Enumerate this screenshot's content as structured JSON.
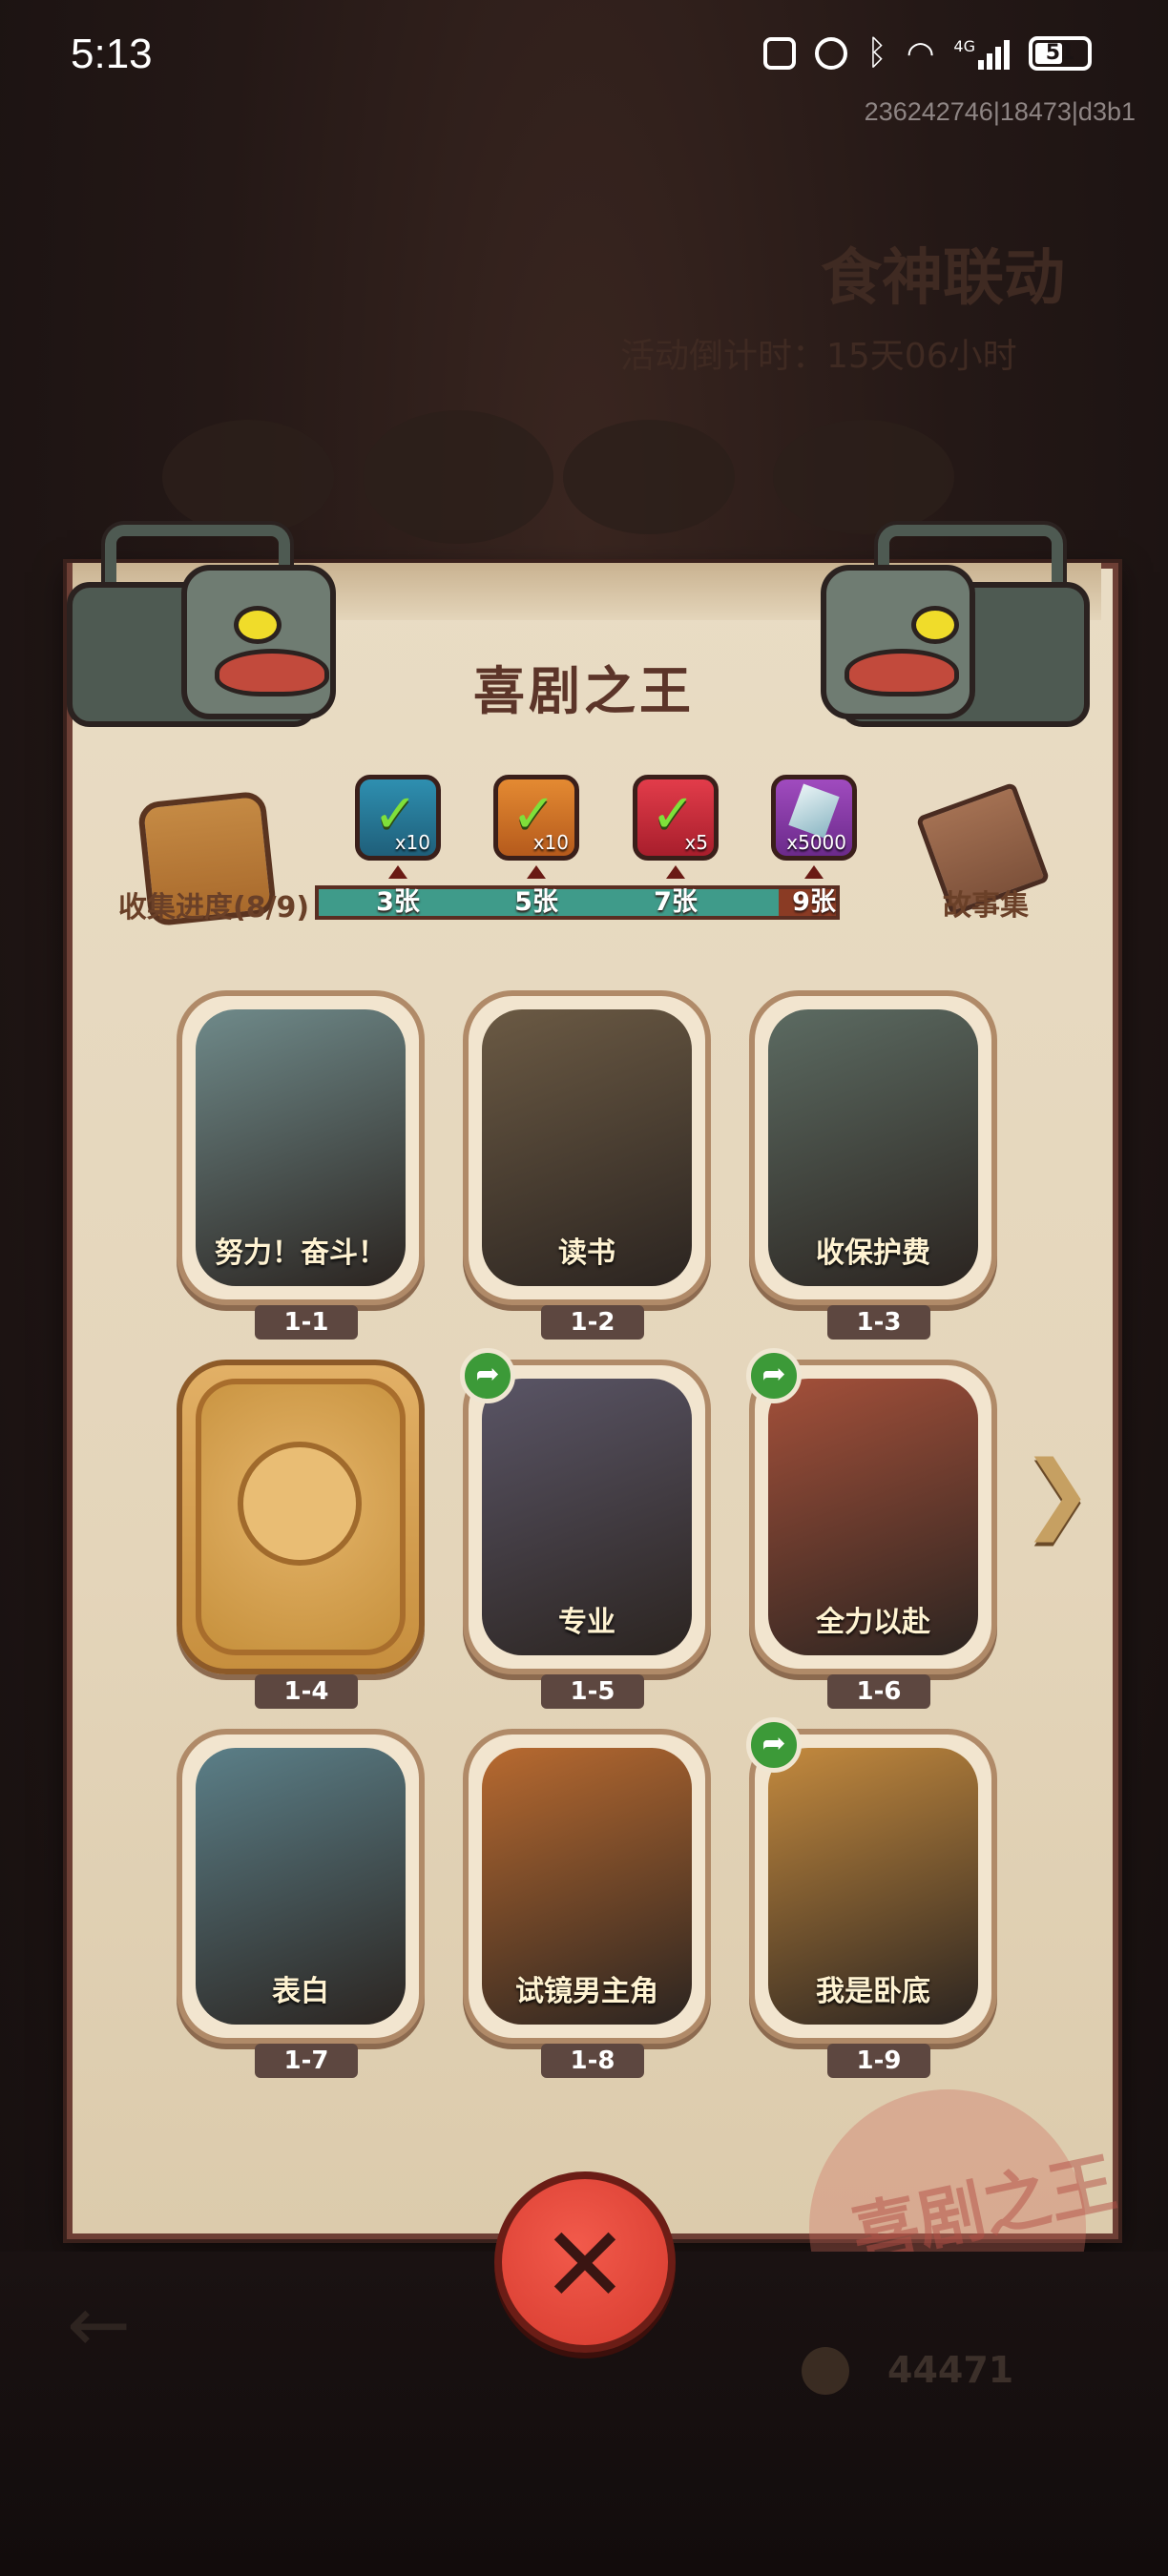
{
  "status_bar": {
    "time": "5:13",
    "battery": "51",
    "network": "4G",
    "session_id": "236242746|18473|d3b1"
  },
  "background": {
    "event_title": "食神联动",
    "countdown": "活动倒计时：15天06小时",
    "coins": "44471"
  },
  "panel": {
    "title": "喜剧之王",
    "collect_label": "收集进度(8/9)",
    "story_label": "故事集"
  },
  "progress": {
    "collected": 8,
    "total": 9,
    "milestones": [
      {
        "label": "3张",
        "reward_qty": "x10",
        "reward": "gift-box-icon",
        "claimed": true
      },
      {
        "label": "5张",
        "reward_qty": "x10",
        "reward": "gift-box-icon",
        "claimed": true
      },
      {
        "label": "7张",
        "reward_qty": "x5",
        "reward": "orb-icon",
        "claimed": true
      },
      {
        "label": "9张",
        "reward_qty": "x5000",
        "reward": "crystal-icon",
        "claimed": false
      }
    ]
  },
  "cards": [
    {
      "code": "1-1",
      "title": "努力！奋斗！",
      "locked": false,
      "shareable": false,
      "art": "#6f8a8a"
    },
    {
      "code": "1-2",
      "title": "读书",
      "locked": false,
      "shareable": false,
      "art": "#6b5a44"
    },
    {
      "code": "1-3",
      "title": "收保护费",
      "locked": false,
      "shareable": false,
      "art": "#5c6b62"
    },
    {
      "code": "1-4",
      "title": "",
      "locked": true,
      "shareable": false,
      "art": "#d9a455"
    },
    {
      "code": "1-5",
      "title": "专业",
      "locked": false,
      "shareable": true,
      "art": "#5a5566"
    },
    {
      "code": "1-6",
      "title": "全力以赴",
      "locked": false,
      "shareable": true,
      "art": "#a4503a"
    },
    {
      "code": "1-7",
      "title": "表白",
      "locked": false,
      "shareable": false,
      "art": "#5b7f88"
    },
    {
      "code": "1-8",
      "title": "试镜男主角",
      "locked": false,
      "shareable": false,
      "art": "#b86a30"
    },
    {
      "code": "1-9",
      "title": "我是卧底",
      "locked": false,
      "shareable": true,
      "art": "#c48a3e"
    }
  ],
  "seal_text": "喜剧之王",
  "icons": {
    "close": "close-icon",
    "next": "next-arrow-icon",
    "share": "share-icon"
  }
}
